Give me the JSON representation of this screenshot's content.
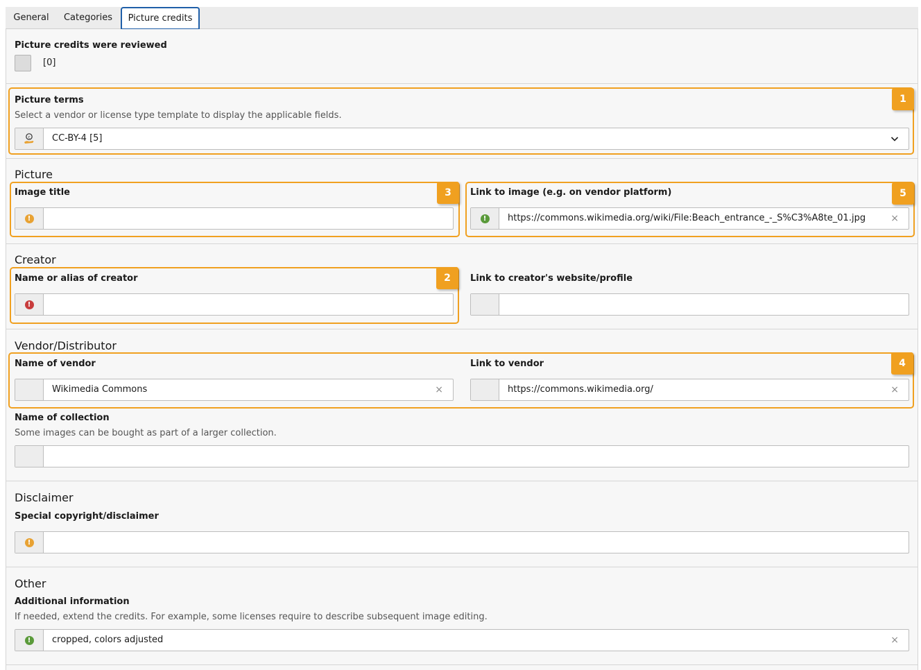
{
  "tabs": [
    {
      "label": "General",
      "active": false
    },
    {
      "label": "Categories",
      "active": false
    },
    {
      "label": "Picture credits",
      "active": true
    }
  ],
  "reviewed": {
    "label": "Picture credits were reviewed",
    "value": "[0]"
  },
  "picture_terms": {
    "badge": "1",
    "label": "Picture terms",
    "description": "Select a vendor or license type template to display the applicable fields.",
    "selected": "CC-BY-4 [5]",
    "icon": "cc-license-icon"
  },
  "picture": {
    "title": "Picture",
    "image_title": {
      "badge": "3",
      "label": "Image title",
      "value": "",
      "status": "warning"
    },
    "image_link": {
      "badge": "5",
      "label": "Link to image (e.g. on vendor platform)",
      "value": "https://commons.wikimedia.org/wiki/File:Beach_entrance_-_S%C3%A8te_01.jpg",
      "status": "ok"
    }
  },
  "creator": {
    "title": "Creator",
    "name": {
      "badge": "2",
      "label": "Name or alias of creator",
      "value": "",
      "status": "error"
    },
    "link": {
      "label": "Link to creator's website/profile",
      "value": ""
    }
  },
  "vendor": {
    "title": "Vendor/Distributor",
    "badge": "4",
    "name": {
      "label": "Name of vendor",
      "value": "Wikimedia Commons"
    },
    "link": {
      "label": "Link to vendor",
      "value": "https://commons.wikimedia.org/"
    },
    "collection": {
      "label": "Name of collection",
      "description": "Some images can be bought as part of a larger collection.",
      "value": ""
    }
  },
  "disclaimer": {
    "title": "Disclaimer",
    "label": "Special copyright/disclaimer",
    "value": "",
    "status": "warning"
  },
  "other": {
    "title": "Other",
    "label": "Additional information",
    "description": "If needed, extend the credits. For example, some licenses require to describe subsequent image editing.",
    "value": "cropped, colors adjusted",
    "status": "ok"
  },
  "colors": {
    "highlight": "#f0a020",
    "active_tab": "#1f5fa8",
    "warning": "#e8a233",
    "error": "#c83c3c",
    "ok": "#5a9a3a"
  }
}
